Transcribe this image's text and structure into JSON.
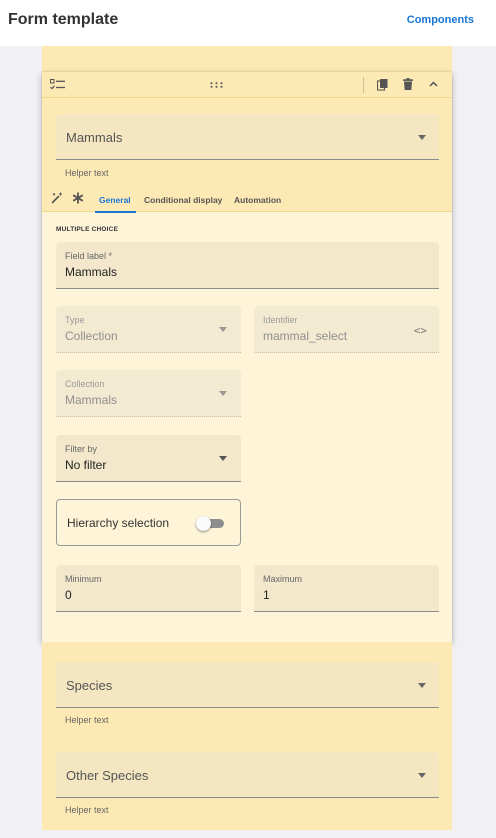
{
  "header": {
    "title": "Form template",
    "components_link": "Components"
  },
  "active_card": {
    "preview_select": {
      "label": "Mammals",
      "helper": "Helper text"
    },
    "tabs": [
      {
        "label": "General",
        "active": true
      },
      {
        "label": "Conditional display",
        "active": false
      },
      {
        "label": "Automation",
        "active": false
      }
    ],
    "section_label": "MULTIPLE CHOICE",
    "fields": {
      "field_label": {
        "label": "Field label *",
        "value": "Mammals"
      },
      "type": {
        "label": "Type",
        "value": "Collection"
      },
      "identifier": {
        "label": "Identifier",
        "value": "mammal_select",
        "action_glyph": "<>"
      },
      "collection": {
        "label": "Collection",
        "value": "Mammals"
      },
      "filter_by": {
        "label": "Filter by",
        "value": "No filter"
      },
      "minimum": {
        "label": "Minimum",
        "value": "0"
      },
      "maximum": {
        "label": "Maximum",
        "value": "1"
      }
    },
    "hierarchy": {
      "label": "Hierarchy selection",
      "enabled": false
    }
  },
  "other_cards": [
    {
      "label": "Species",
      "helper": "Helper text"
    },
    {
      "label": "Other Species",
      "helper": "Helper text"
    }
  ],
  "colors": {
    "accent": "#1976d2",
    "card_header": "#fde9b3",
    "card_body": "#fef5d9"
  }
}
